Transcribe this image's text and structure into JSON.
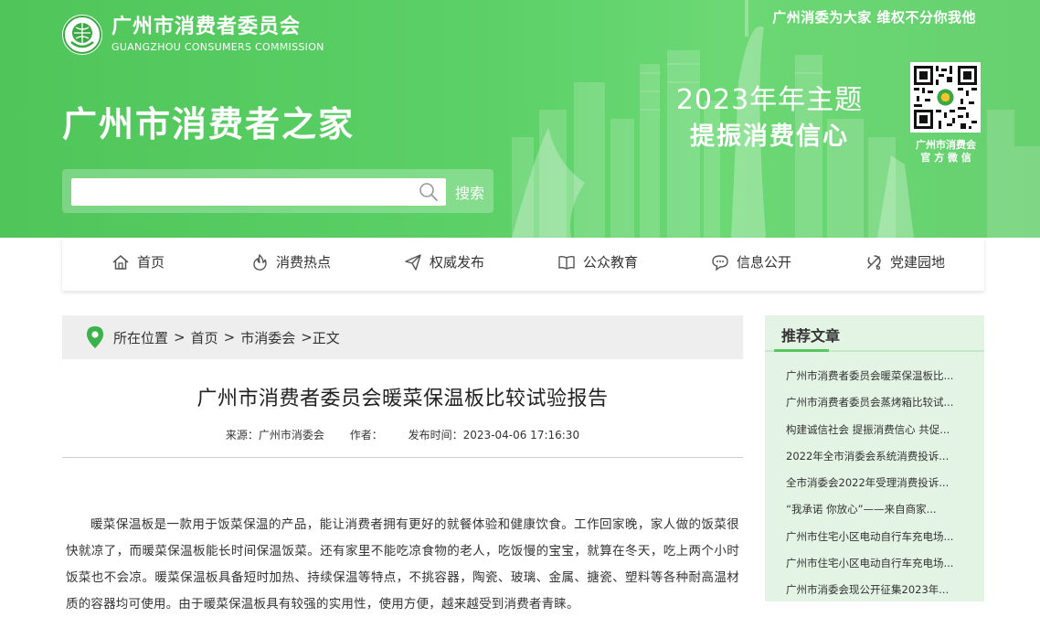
{
  "header": {
    "logo_cn": "广州市消费者委员会",
    "logo_en": "GUANGZHOU CONSUMERS COMMISSION",
    "slogan": "广州消委为大家 维权不分你我他",
    "site_title": "广州市消费者之家",
    "theme_line1": "2023年年主题",
    "theme_line2": "提振消费信心",
    "qr_caption_line1": "广州市消费会",
    "qr_caption_line2": "官 方 微 信",
    "search_placeholder": "",
    "search_button": "搜索"
  },
  "nav": {
    "items": [
      {
        "label": "首页",
        "icon": "home-icon"
      },
      {
        "label": "消费热点",
        "icon": "flame-icon"
      },
      {
        "label": "权威发布",
        "icon": "send-icon"
      },
      {
        "label": "公众教育",
        "icon": "book-icon"
      },
      {
        "label": "信息公开",
        "icon": "chat-icon"
      },
      {
        "label": "党建园地",
        "icon": "party-icon"
      }
    ]
  },
  "breadcrumb": {
    "prefix": "所在位置",
    "items": [
      "首页",
      "市消委会",
      "正文"
    ]
  },
  "article": {
    "title": "广州市消费者委员会暖菜保温板比较试验报告",
    "source_label": "来源：",
    "source": "广州市消委会",
    "author_label": "作者：",
    "author": "",
    "date_label": "发布时间：",
    "date": "2023-04-06 17:16:30",
    "body": "暖菜保温板是一款用于饭菜保温的产品，能让消费者拥有更好的就餐体验和健康饮食。工作回家晚，家人做的饭菜很快就凉了，而暖菜保温板能长时间保温饭菜。还有家里不能吃凉食物的老人，吃饭慢的宝宝，就算在冬天，吃上两个小时饭菜也不会凉。暖菜保温板具备短时加热、持续保温等特点，不挑容器，陶瓷、玻璃、金属、搪瓷、塑料等各种耐高温材质的容器均可使用。由于暖菜保温板具有较强的实用性，使用方便，越来越受到消费者青睐。"
  },
  "sidebar": {
    "title": "推荐文章",
    "items": [
      "广州市消费者委员会暖菜保温板比...",
      "广州市消费者委员会蒸烤箱比较试...",
      "构建诚信社会 提振消费信心 共促...",
      "2022年全市消委会系统消费投诉...",
      "全市消委会2022年受理消费投诉...",
      "“我承诺 你放心”——来自商家...",
      "广州市住宅小区电动自行车充电场...",
      "广州市住宅小区电动自行车充电场...",
      "广州市消委会现公开征集2023年..."
    ]
  },
  "colors": {
    "banner_green": "#5bd066",
    "sidebar_bg": "#e4f4e4",
    "crumb_bg": "#eeeeee",
    "accent_green": "#3bb34a"
  }
}
